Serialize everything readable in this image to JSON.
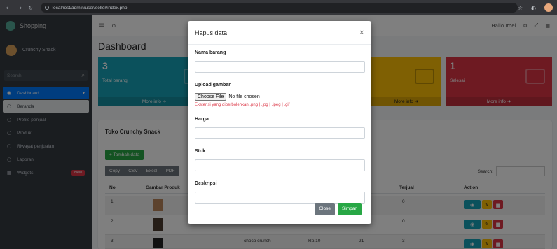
{
  "browser": {
    "url": "localhost/admin/user/seller/index.php"
  },
  "sidebar": {
    "brand": "Shopping",
    "user": "Crunchy Snack",
    "search_placeholder": "Search",
    "items": [
      {
        "label": "Dashboard",
        "icon": "dashboard-icon"
      },
      {
        "label": "Beranda",
        "icon": "circle-icon"
      },
      {
        "label": "Profile penjual",
        "icon": "circle-icon"
      },
      {
        "label": "Produk",
        "icon": "circle-icon"
      },
      {
        "label": "Riwayat penjualan",
        "icon": "circle-icon"
      },
      {
        "label": "Laporan",
        "icon": "circle-icon"
      },
      {
        "label": "Widgets",
        "icon": "grid-icon",
        "badge": "New"
      }
    ]
  },
  "topnav": {
    "user": "Hallo Imel"
  },
  "main": {
    "title": "Dashboard",
    "boxes": [
      {
        "number": "3",
        "label": "Total barang",
        "more": "More info",
        "color": "#17a2b8"
      },
      {
        "number": "",
        "label": "",
        "more": "More info",
        "color": "#ffc107"
      },
      {
        "number": "1",
        "label": "Selesai",
        "more": "More info",
        "color": "#dc3545"
      }
    ],
    "card_title": "Toko Crunchy Snack",
    "add_button": "Tambah data",
    "export_buttons": [
      "Copy",
      "CSV",
      "Excel",
      "PDF"
    ],
    "search_label": "Search:",
    "table_headers": [
      "No",
      "Gambar Produk",
      "Terjual",
      "Action"
    ],
    "rows": [
      {
        "no": "1",
        "name": "",
        "price": "",
        "stock": "",
        "sold": "0"
      },
      {
        "no": "2",
        "name": "",
        "price": "",
        "stock": "",
        "sold": "0"
      },
      {
        "no": "3",
        "name": "choco crunch",
        "price": "Rp.10",
        "stock": "21",
        "sold": "3"
      }
    ]
  },
  "modal": {
    "title": "Hapus data",
    "close": "×",
    "fields": {
      "nama_label": "Nama barang",
      "gambar_label": "Upload gambar",
      "file_button": "Choose File",
      "file_status": "No file chosen",
      "file_help": "Ekstensi yang diperbolehkan .png | .jpg | .jpeg | .gif",
      "harga_label": "Harga",
      "stok_label": "Stok",
      "deskripsi_label": "Deskripsi"
    },
    "close_button": "Close",
    "save_button": "Simpan"
  }
}
